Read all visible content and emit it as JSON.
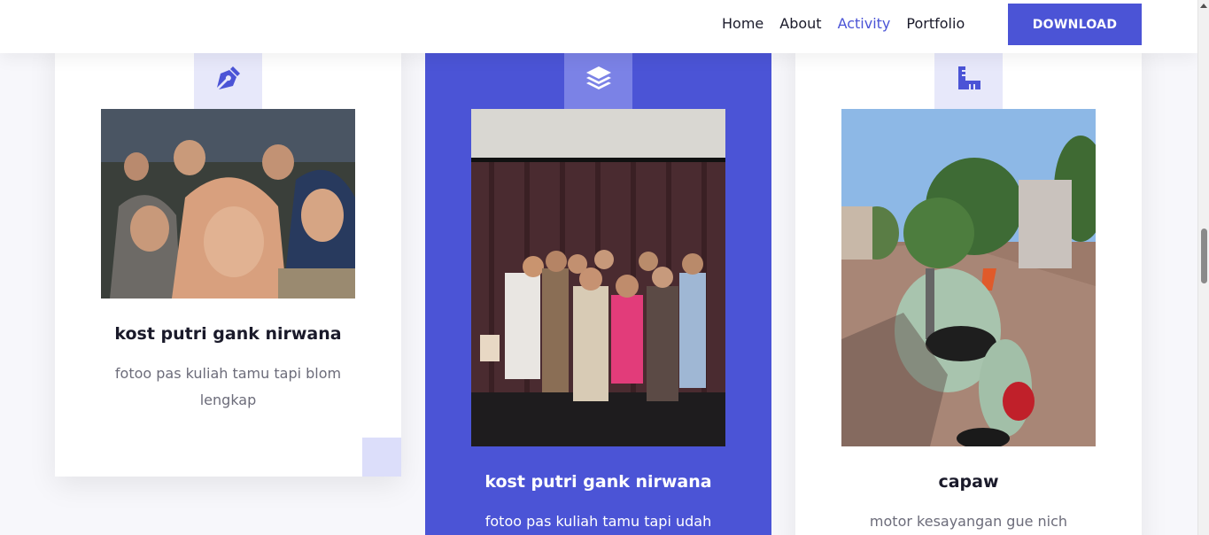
{
  "nav": {
    "links": [
      {
        "label": "Home",
        "active": false
      },
      {
        "label": "About",
        "active": false
      },
      {
        "label": "Activity",
        "active": true
      },
      {
        "label": "Portfolio",
        "active": false
      }
    ],
    "download_label": "DOWNLOAD"
  },
  "colors": {
    "accent": "#4b54d6",
    "icon_bg": "#e7e8fa",
    "icon_bg_featured": "#7b82e6",
    "text_dark": "#1a1a2a",
    "text_muted": "#6c6c7a"
  },
  "cards": [
    {
      "icon": "pen-nib-icon",
      "title": "kost putri gank nirwana",
      "description": "fotoo pas kuliah tamu tapi blom lengkap",
      "featured": false
    },
    {
      "icon": "layers-icon",
      "title": "kost putri gank nirwana",
      "description": "fotoo pas kuliah tamu tapi udah",
      "featured": true
    },
    {
      "icon": "ruler-icon",
      "title": "capaw",
      "description": "motor kesayangan gue nich",
      "featured": false
    }
  ]
}
